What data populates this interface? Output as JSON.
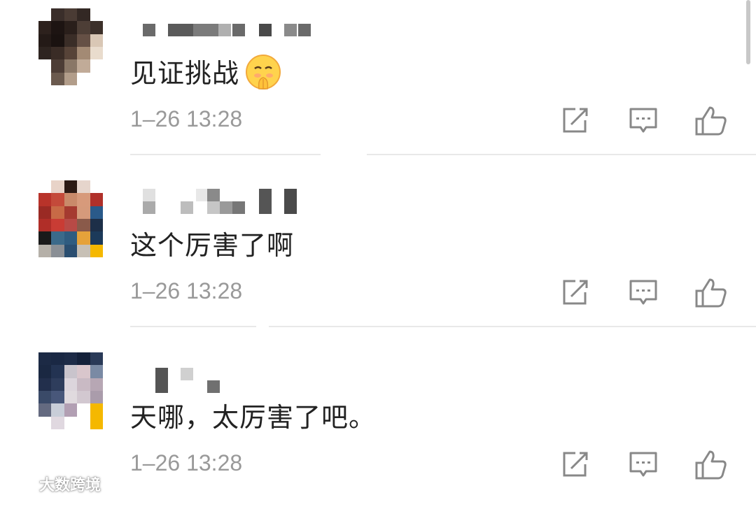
{
  "comments": [
    {
      "text": "见证挑战",
      "time": "1–26 13:28",
      "has_emoji": true,
      "emoji": "hushed-face-with-hand"
    },
    {
      "text": "这个厉害了啊",
      "time": "1–26 13:28",
      "has_emoji": false
    },
    {
      "text": "天哪，太厉害了吧。",
      "time": "1–26 13:28",
      "has_emoji": false
    }
  ],
  "actions": {
    "share_icon": "share-icon",
    "reply_icon": "comment-icon",
    "like_icon": "thumbs-up-icon"
  },
  "watermark": {
    "text": "大数跨境"
  },
  "colors": {
    "text": "#222222",
    "meta": "#999999",
    "divider": "#e8e8e8",
    "icon": "#888888"
  }
}
